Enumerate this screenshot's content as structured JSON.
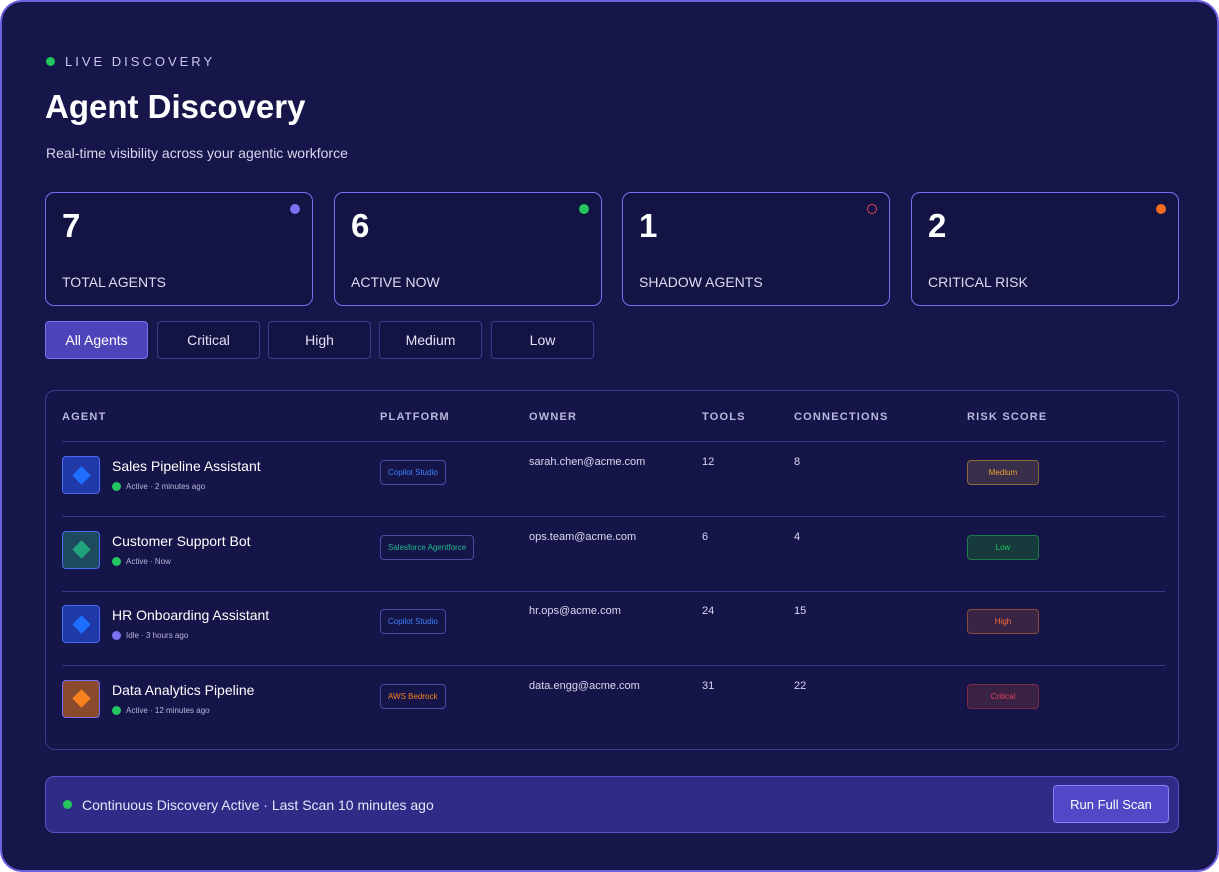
{
  "header": {
    "live_label": "LIVE DISCOVERY",
    "title": "Agent Discovery",
    "subtitle": "Real-time visibility across your agentic workforce"
  },
  "stats": [
    {
      "value": "7",
      "label": "TOTAL AGENTS",
      "indicator_color": "#7c6ff0",
      "indicator_style": "filled"
    },
    {
      "value": "6",
      "label": "ACTIVE NOW",
      "indicator_color": "#22c55e",
      "indicator_style": "filled"
    },
    {
      "value": "1",
      "label": "SHADOW AGENTS",
      "indicator_color": "#e0405a",
      "indicator_style": "outline"
    },
    {
      "value": "2",
      "label": "CRITICAL RISK",
      "indicator_color": "#f26b21",
      "indicator_style": "filled"
    }
  ],
  "filters": {
    "active": "All Agents",
    "items": [
      "All Agents",
      "Critical",
      "High",
      "Medium",
      "Low"
    ]
  },
  "table": {
    "columns": [
      "AGENT",
      "PLATFORM",
      "OWNER",
      "TOOLS",
      "CONNECTIONS",
      "RISK SCORE"
    ],
    "rows": [
      {
        "name": "Sales Pipeline Assistant",
        "status": "Active · 2 minutes ago",
        "status_color": "#22c55e",
        "icon": "diamond-icon",
        "icon_bg": "#1f3aa8",
        "icon_border": "#4a6cf0",
        "icon_color": "#1e6fff",
        "platform": "Copilot Studio",
        "platform_color": "#3b82f6",
        "owner": "sarah.chen@acme.com",
        "tools": "12",
        "connections": "8",
        "risk": "Medium",
        "risk_color": "#e5a33a",
        "risk_bg": "#3a2f4a",
        "risk_border": "#8a6a3a"
      },
      {
        "name": "Customer Support Bot",
        "status": "Active · Now",
        "status_color": "#22c55e",
        "icon": "diamond-icon",
        "icon_bg": "#1d4a5e",
        "icon_border": "#4a6cf0",
        "icon_color": "#1fa37a",
        "platform": "Salesforce Agentforce",
        "platform_color": "#1fb88a",
        "owner": "ops.team@acme.com",
        "tools": "6",
        "connections": "4",
        "risk": "Low",
        "risk_color": "#22c55e",
        "risk_bg": "#173a3e",
        "risk_border": "#1f7a4a"
      },
      {
        "name": "HR Onboarding Assistant",
        "status": "Idle · 3 hours ago",
        "status_color": "#7c6ff0",
        "icon": "diamond-icon",
        "icon_bg": "#1f3aa8",
        "icon_border": "#4a6cf0",
        "icon_color": "#1e6fff",
        "platform": "Copilot Studio",
        "platform_color": "#3b82f6",
        "owner": "hr.ops@acme.com",
        "tools": "24",
        "connections": "15",
        "risk": "High",
        "risk_color": "#f26b3a",
        "risk_bg": "#3a2444",
        "risk_border": "#8a4a3a"
      },
      {
        "name": "Data Analytics Pipeline",
        "status": "Active · 12 minutes ago",
        "status_color": "#22c55e",
        "icon": "diamond-icon",
        "icon_bg": "#8a4a2e",
        "icon_border": "#7a6ef0",
        "icon_color": "#f7821f",
        "platform": "AWS Bedrock",
        "platform_color": "#f7821f",
        "owner": "data.engg@acme.com",
        "tools": "31",
        "connections": "22",
        "risk": "Critical",
        "risk_color": "#e0405a",
        "risk_bg": "#3a2244",
        "risk_border": "#7a2a44"
      }
    ]
  },
  "footer": {
    "status_text": "Continuous Discovery Active · Last Scan 10 minutes ago",
    "scan_button": "Run Full Scan"
  }
}
